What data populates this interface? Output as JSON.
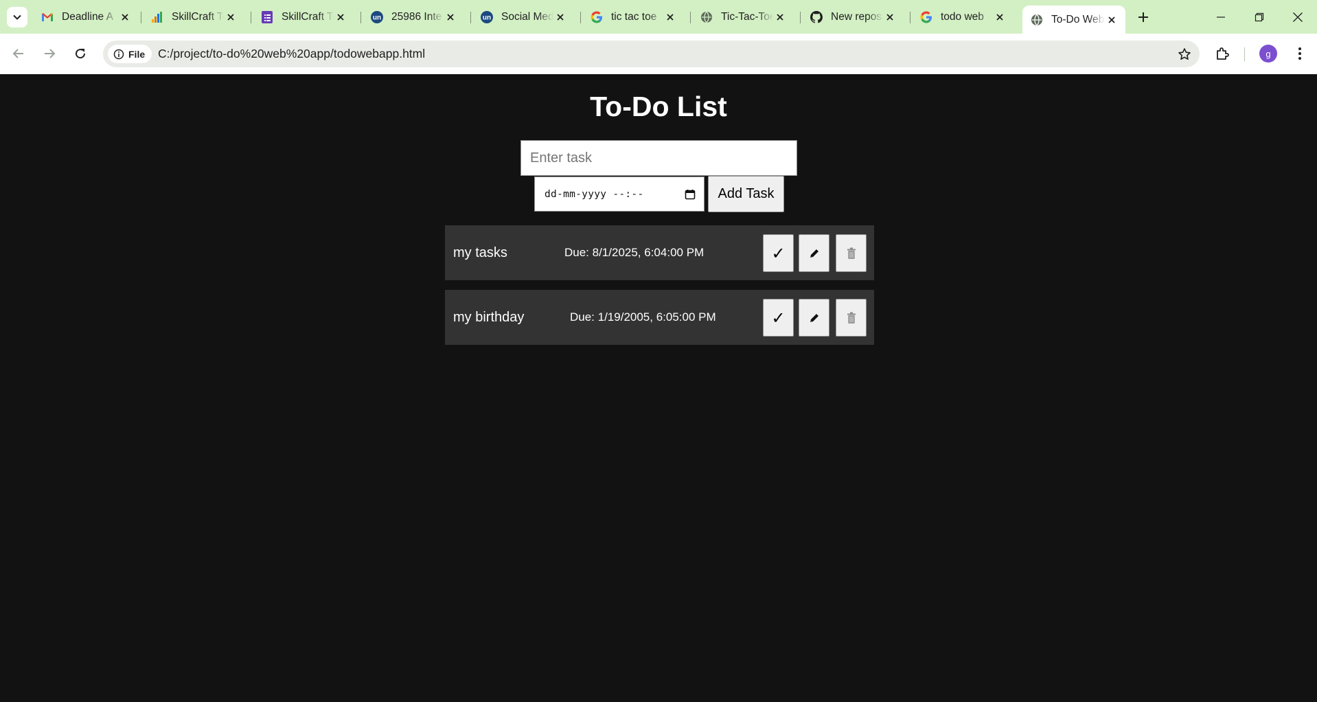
{
  "browser": {
    "tabs": [
      {
        "title": "Deadline A",
        "icon": "gmail-icon"
      },
      {
        "title": "SkillCraft Te",
        "icon": "analytics-icon"
      },
      {
        "title": "SkillCraft Te",
        "icon": "forms-icon"
      },
      {
        "title": "25986 Inte",
        "icon": "unstop-icon"
      },
      {
        "title": "Social Med",
        "icon": "unstop-icon"
      },
      {
        "title": "tic tac toe",
        "icon": "google-icon"
      },
      {
        "title": "Tic-Tac-Toe",
        "icon": "globe-icon"
      },
      {
        "title": "New repos",
        "icon": "github-icon"
      },
      {
        "title": "todo web",
        "icon": "google-icon"
      },
      {
        "title": "To-Do Web",
        "icon": "globe-icon",
        "active": true
      }
    ],
    "security_chip": "File",
    "url": "C:/project/to-do%20web%20app/todowebapp.html",
    "profile_initial": "g",
    "colors": {
      "tabstrip": "#d3efc4",
      "profile": "#7b4fcf"
    }
  },
  "app": {
    "title": "To-Do List",
    "task_placeholder": "Enter task",
    "datetime_placeholder": "dd-mm-yyyy --:--",
    "add_button": "Add Task",
    "tasks": [
      {
        "name": "my tasks",
        "due": "Due: 8/1/2025, 6:04:00 PM"
      },
      {
        "name": "my birthday",
        "due": "Due: 1/19/2005, 6:05:00 PM"
      }
    ],
    "actions": {
      "complete": "✓",
      "edit": "pencil-icon",
      "delete": "trash-icon"
    },
    "colors": {
      "background": "#121212",
      "row": "#333333",
      "button": "#efefef"
    }
  }
}
